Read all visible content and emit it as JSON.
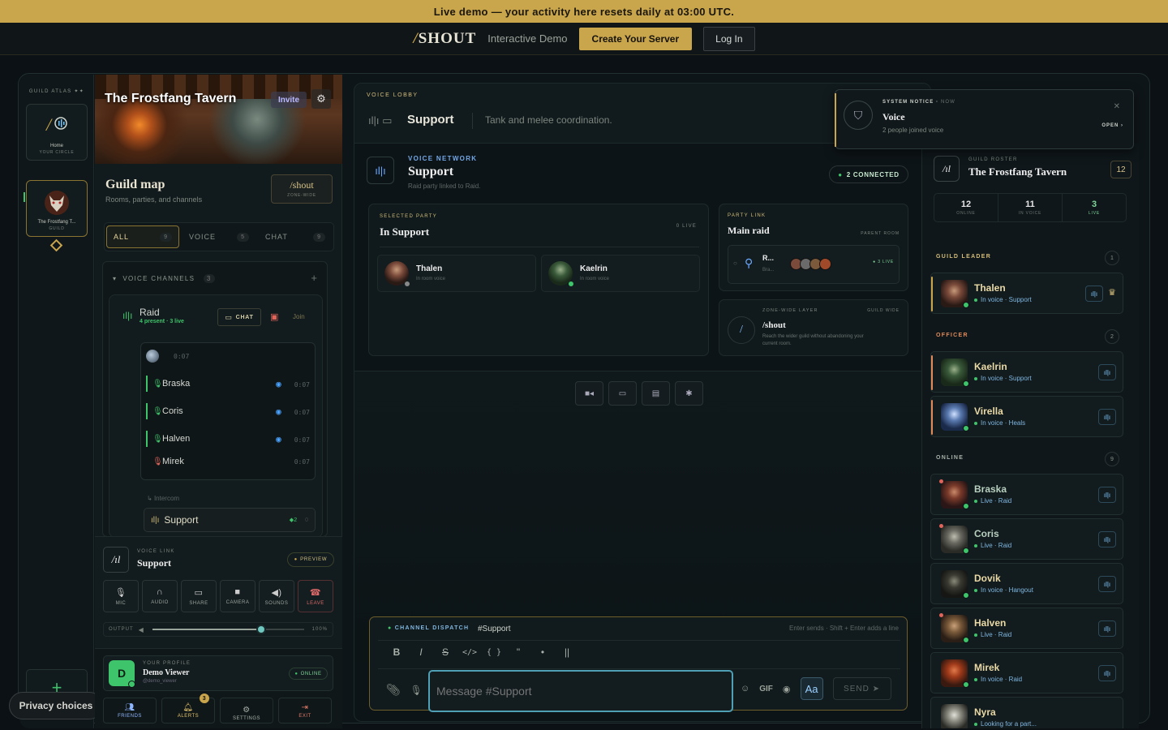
{
  "banner": {
    "text": "Live demo — your activity here resets daily at 03:00 UTC."
  },
  "topbar": {
    "logo_slash": "/",
    "logo_text": "SHOUT",
    "subtitle": "Interactive Demo",
    "create_label": "Create Your Server",
    "login_label": "Log In"
  },
  "rail": {
    "label": "GUILD ATLAS",
    "home": "Home",
    "home_sub": "YOUR CIRCLE",
    "guild": "The Frostfang T...",
    "guild_sub": "GUILD",
    "add": "+"
  },
  "privacy": "Privacy choices",
  "guild": {
    "name": "The Frostfang Tavern",
    "invite": "Invite",
    "map_title": "Guild map",
    "map_sub": "Rooms, parties, and channels",
    "shout_btn": "/shout",
    "shout_sub": "ZONE-WIDE",
    "filters": [
      {
        "label": "ALL",
        "count": "9"
      },
      {
        "label": "VOICE",
        "count": "5"
      },
      {
        "label": "CHAT",
        "count": "9"
      }
    ],
    "voice_channels_label": "VOICE CHANNELS",
    "voice_channels_count": "3",
    "raid": {
      "name": "Raid",
      "sub": "4 present · 3 live",
      "chat": "CHAT",
      "join": "Join"
    },
    "members": [
      {
        "name": "",
        "time": "0:07"
      },
      {
        "name": "Braska",
        "time": "0:07"
      },
      {
        "name": "Coris",
        "time": "0:07"
      },
      {
        "name": "Halven",
        "time": "0:07"
      },
      {
        "name": "Mirek",
        "time": "0:07"
      }
    ],
    "intercom": "Intercom",
    "support_channel": {
      "name": "Support",
      "count": "2",
      "extra": "0"
    }
  },
  "voice_link": {
    "label": "VOICE LINK",
    "name": "Support",
    "preview": "PREVIEW",
    "controls": [
      "MIC",
      "AUDIO",
      "SHARE",
      "CAMERA",
      "SOUNDS",
      "LEAVE"
    ],
    "output_label": "OUTPUT",
    "output_value": "100%",
    "output_level": 0.72
  },
  "profile": {
    "label": "YOUR PROFILE",
    "name": "Demo Viewer",
    "handle": "@demo_viewer",
    "initial": "D",
    "status": "ONLINE",
    "nav": [
      "FRIENDS",
      "ALERTS",
      "SETTINGS",
      "EXIT"
    ],
    "alerts_count": "3"
  },
  "lobby": {
    "label": "VOICE LOBBY",
    "name": "Support",
    "desc": "Tank and melee coordination.",
    "network_label": "VOICE NETWORK",
    "network_name": "Support",
    "network_sub": "Raid party linked to Raid.",
    "connected": "2 CONNECTED",
    "selected_label": "SELECTED PARTY",
    "selected_name": "In Support",
    "selected_live": "0 LIVE",
    "party_members": [
      {
        "name": "Thalen",
        "status": "In room voice"
      },
      {
        "name": "Kaelrin",
        "status": "In room voice"
      }
    ],
    "party_link_label": "PARTY LINK",
    "party_link_name": "Main raid",
    "parent_room": "PARENT ROOM",
    "link_title": "R...",
    "link_sub": "Bra...",
    "link_live": "3 LIVE",
    "zone_label": "ZONE-WIDE LAYER",
    "zone_wide": "GUILD WIDE",
    "zone_name": "/shout",
    "zone_desc": "Reach the wider guild without abandoning your current room."
  },
  "composer": {
    "label": "CHANNEL DISPATCH",
    "channel": "#Support",
    "hint": "Enter sends · Shift + Enter adds a line",
    "placeholder": "Message #Support",
    "gif": "GIF",
    "aa": "Aa",
    "send": "SEND"
  },
  "toast": {
    "label": "SYSTEM NOTICE",
    "time": "NOW",
    "name": "Voice",
    "desc": "2 people joined voice",
    "open": "OPEN"
  },
  "roster": {
    "label": "GUILD ROSTER",
    "name": "The Frostfang Tavern",
    "count": "12",
    "stats": [
      {
        "value": "12",
        "label": "ONLINE"
      },
      {
        "value": "11",
        "label": "IN VOICE"
      },
      {
        "value": "3",
        "label": "LIVE"
      }
    ],
    "sections": [
      {
        "title": "GUILD LEADER",
        "count": "1"
      },
      {
        "title": "OFFICER",
        "count": "2"
      },
      {
        "title": "ONLINE",
        "count": "9"
      }
    ],
    "leader": [
      {
        "name": "Thalen",
        "status": "In voice · Support"
      }
    ],
    "officers": [
      {
        "name": "Kaelrin",
        "status": "In voice · Support"
      },
      {
        "name": "Virella",
        "status": "In voice · Heals"
      }
    ],
    "online": [
      {
        "name": "Braska",
        "status": "Live · Raid"
      },
      {
        "name": "Coris",
        "status": "Live · Raid"
      },
      {
        "name": "Dovik",
        "status": "In voice · Hangout"
      },
      {
        "name": "Halven",
        "status": "Live · Raid"
      },
      {
        "name": "Mirek",
        "status": "In voice · Raid"
      },
      {
        "name": "Nyra",
        "status": "Looking for a part..."
      }
    ]
  },
  "colors": {
    "accent": "#c9a54b",
    "online": "#3ec46a",
    "voice": "#7fb6e0"
  }
}
